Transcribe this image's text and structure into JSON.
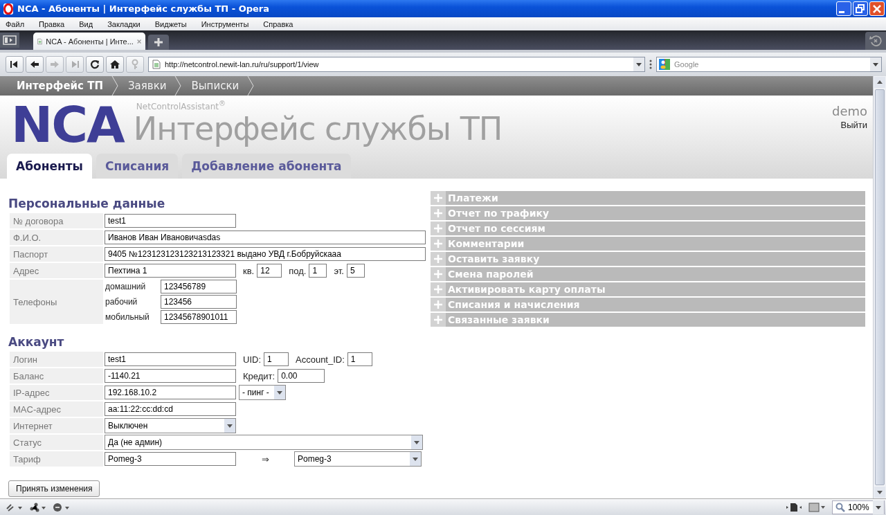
{
  "window": {
    "title": "NCA - Абоненты | Интерфейс службы ТП - Opera"
  },
  "menu": [
    "Файл",
    "Правка",
    "Вид",
    "Закладки",
    "Виджеты",
    "Инструменты",
    "Справка"
  ],
  "browser_tabs": [
    {
      "title": "NCA - Абоненты | Инте...",
      "selected": true
    }
  ],
  "address": {
    "url": "http://netcontrol.newit-lan.ru/ru/support/1/view"
  },
  "search": {
    "placeholder": "Google"
  },
  "breadcrumbs": [
    {
      "label": "Интерфейс ТП",
      "selected": true
    },
    {
      "label": "Заявки",
      "selected": false
    },
    {
      "label": "Выписки",
      "selected": false
    }
  ],
  "header": {
    "logo": "NCA",
    "brand": "NetControlAssistant$^{®}$",
    "title": "Интерфейс службы ТП",
    "user": "demo",
    "logout": "Выйти"
  },
  "tabs": [
    {
      "label": "Абоненты",
      "selected": true
    },
    {
      "label": "Списания",
      "selected": false
    },
    {
      "label": "Добавление абонента",
      "selected": false
    }
  ],
  "sections": [
    {
      "title": "Персональные данные",
      "rows": [
        {
          "kind": "fields",
          "label": "№ договора",
          "controls": [
            {
              "kind": "input",
              "value": "test1"
            }
          ]
        },
        {
          "kind": "fields",
          "label": "Ф.И.О.",
          "controls": [
            {
              "kind": "wide_input",
              "value": "Иванов Иван Ивановичаsdas"
            }
          ]
        },
        {
          "kind": "fields",
          "label": "Паспорт",
          "controls": [
            {
              "kind": "wide_input",
              "value": "9405 №123123123123213123321 выдано УВД г.Бобруйскааа"
            }
          ]
        },
        {
          "kind": "fields",
          "label": "Адрес",
          "controls": [
            {
              "kind": "input",
              "value": "Пехтина 1"
            },
            {
              "kind": "caption",
              "text": "кв."
            },
            {
              "kind": "small_input",
              "value": "12"
            },
            {
              "kind": "caption",
              "text": "под."
            },
            {
              "kind": "tiny_input",
              "value": "1"
            },
            {
              "kind": "caption",
              "text": "эт."
            },
            {
              "kind": "tiny_input",
              "value": "5"
            }
          ]
        },
        {
          "kind": "phones",
          "label": "Телефоны",
          "phones": [
            {
              "label": "домашний",
              "value": "123456789"
            },
            {
              "label": "рабочий",
              "value": "123456"
            },
            {
              "label": "мобильный",
              "value": "12345678901011"
            }
          ]
        }
      ]
    },
    {
      "title": "Аккаунт",
      "rows": [
        {
          "kind": "fields",
          "label": "Логин",
          "controls": [
            {
              "kind": "input",
              "value": "test1"
            },
            {
              "kind": "caption",
              "text": "UID:"
            },
            {
              "kind": "small_input",
              "value": "1"
            },
            {
              "kind": "caption",
              "text": "Account_ID:"
            },
            {
              "kind": "small_input",
              "value": "1"
            }
          ]
        },
        {
          "kind": "fields",
          "label": "Баланс",
          "controls": [
            {
              "kind": "input",
              "value": "-1140.21"
            },
            {
              "kind": "caption",
              "text": "Кредит:"
            },
            {
              "kind": "medium_input",
              "value": "0.00"
            }
          ]
        },
        {
          "kind": "fields",
          "label": "IP-адрес",
          "controls": [
            {
              "kind": "input",
              "value": "192.168.10.2"
            },
            {
              "kind": "small_select",
              "value": "- пинг -"
            }
          ]
        },
        {
          "kind": "fields",
          "label": "MAC-адрес",
          "controls": [
            {
              "kind": "input",
              "value": "aa:11:22:cc:dd:cd"
            }
          ]
        },
        {
          "kind": "fields",
          "label": "Интернет",
          "controls": [
            {
              "kind": "select",
              "value": "Выключен"
            }
          ]
        },
        {
          "kind": "fields",
          "label": "Статус",
          "controls": [
            {
              "kind": "wide_select",
              "value": "Да (не админ)"
            }
          ]
        },
        {
          "kind": "fields",
          "label": "Тариф",
          "controls": [
            {
              "kind": "input",
              "value": "Pomeg-3"
            },
            {
              "kind": "arrow",
              "text": "⇒"
            },
            {
              "kind": "select_end",
              "value": "Pomeg-3"
            }
          ]
        }
      ]
    }
  ],
  "submit": "Принять изменения",
  "panels": [
    {
      "title": "Платежи",
      "expanded": false
    },
    {
      "title": "Отчет по трафику",
      "expanded": false
    },
    {
      "title": "Отчет по сессиям",
      "expanded": false
    },
    {
      "title": "Комментарии",
      "expanded": false
    },
    {
      "title": "Оставить заявку",
      "expanded": false
    },
    {
      "title": "Смена паролей",
      "expanded": false
    },
    {
      "title": "Активировать карту оплаты",
      "expanded": false
    },
    {
      "title": "Списания и начисления",
      "expanded": false
    },
    {
      "title": "Связанные заявки",
      "expanded": false
    }
  ],
  "status_bar": {
    "zoom": "100%"
  }
}
